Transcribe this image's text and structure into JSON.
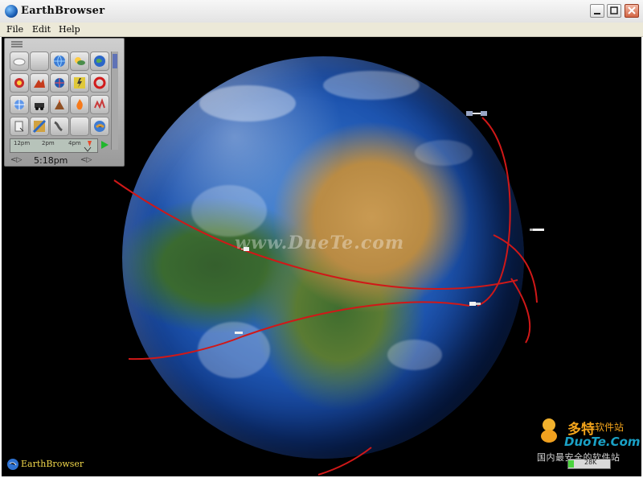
{
  "window": {
    "title": "EarthBrowser"
  },
  "menu": {
    "items": [
      "File",
      "Edit",
      "Help"
    ]
  },
  "tool_panel": {
    "timeline_ticks": [
      "12pm",
      "2pm",
      "4pm"
    ],
    "time_label": "5:18pm",
    "arrow_left": "<▷",
    "arrow_right": "<▷"
  },
  "globe": {
    "watermark": "www.DueTe.com"
  },
  "branding": {
    "bottom_left": "EarthBrowser",
    "site_cn": "多特",
    "site_cn_small": "软件站",
    "site_en": "DuoTe.Com",
    "slogan": "国内最安全的软件站",
    "status": "28K"
  }
}
